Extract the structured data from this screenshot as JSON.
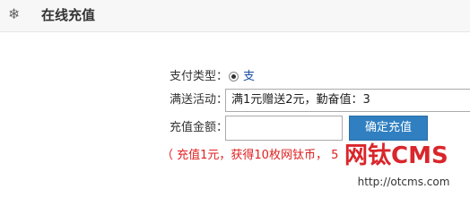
{
  "header": {
    "icon": "snowflake-gear-icon",
    "title": "在线充值"
  },
  "form": {
    "payment_type": {
      "label": "支付类型：",
      "option_label": "支付宝",
      "selected": true
    },
    "promotion": {
      "label": "满送活动：",
      "value": "满1元赠送2元，勤奋值：3"
    },
    "amount": {
      "label": "充值金额：",
      "value": "",
      "placeholder": ""
    },
    "submit_label": "确定充值",
    "note": "（ 充值1元，获得10枚网钛币， 5"
  },
  "watermark": {
    "brand": "网钛CMS",
    "url": "http://otcms.com"
  },
  "colors": {
    "accent": "#2f7fc1",
    "note": "#e02020",
    "link": "#1e50a2",
    "brand": "#d9262b"
  }
}
